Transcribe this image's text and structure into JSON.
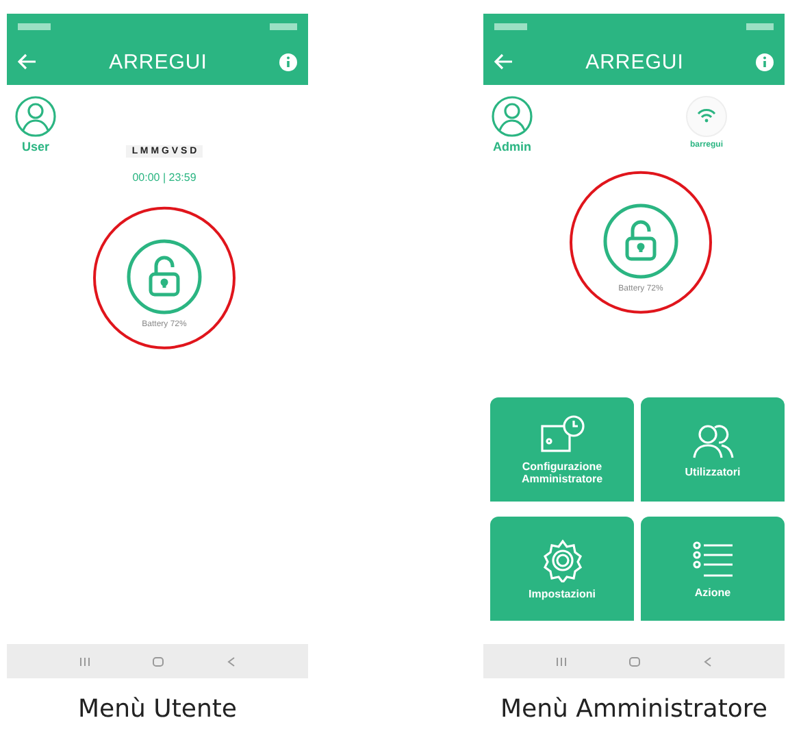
{
  "screens": [
    {
      "kind": "user",
      "title": "ARREGUI",
      "role": "User",
      "days": "L M M G V S D",
      "schedule": "00:00 | 23:59",
      "battery": "Battery 72%",
      "highlighted": true,
      "caption": "Menù Utente"
    },
    {
      "kind": "admin",
      "title": "ARREGUI",
      "role": "Admin",
      "network": "barregui",
      "battery": "Battery 72%",
      "highlighted": true,
      "caption": "Menù Amministratore",
      "tiles": [
        {
          "label": "Configurazione Amministratore",
          "kind": "config"
        },
        {
          "label": "Utilizzatori",
          "kind": "users"
        },
        {
          "label": "Impostazioni",
          "kind": "gear"
        },
        {
          "label": "Azione",
          "kind": "list"
        }
      ]
    }
  ]
}
